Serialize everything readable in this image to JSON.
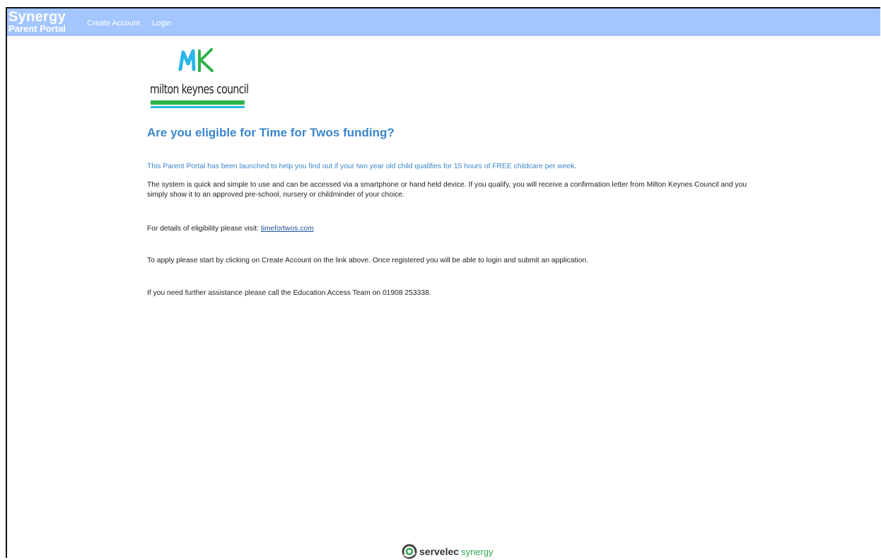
{
  "header": {
    "brand_title": "Synergy",
    "brand_subtitle": "Parent Portal",
    "nav": [
      "Create Account",
      "Login"
    ]
  },
  "logo": {
    "text": "milton keynes council",
    "mark": "MK"
  },
  "main": {
    "heading": "Are you eligible for Time for Twos funding?",
    "intro": "This Parent Portal has been launched to help you find out if your two year old child qualifies for 15 hours of FREE childcare per week.",
    "system_text": "The system is quick and simple to use and can be accessed via a smartphone or hand held device. If you qualify, you will receive a confirmation letter from Milton Keynes Council and you simply show it to an approved pre-school, nursery or childminder of your choice.",
    "eligibility_prefix": "For details of eligibility please visit: ",
    "eligibility_link": "timefortwos.com",
    "apply_text": "To apply please start by clicking on Create Account on the link above. Once registered you will be able to login and submit an application.",
    "assistance_text": "If you need further assistance please call the Education Access Team on 01908 253338."
  },
  "footer": {
    "brand_part1": "servelec",
    "brand_part2": "synergy"
  },
  "colors": {
    "topbar": "#a3c6ff",
    "heading": "#3a86cc",
    "link": "#1d4f9a",
    "logo_green": "#2fb24a",
    "logo_cyan": "#2ab6e8"
  }
}
